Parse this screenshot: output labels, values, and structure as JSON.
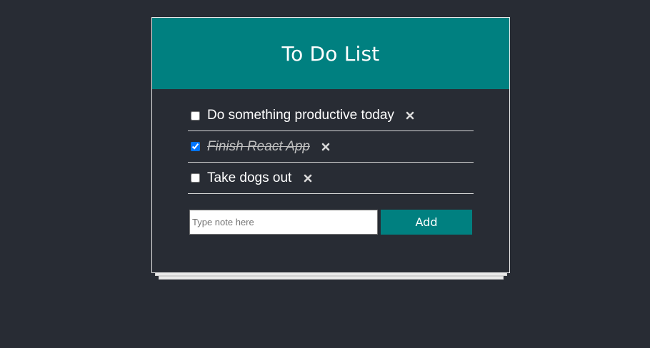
{
  "app": {
    "title": "To Do List"
  },
  "todos": [
    {
      "text": "Do something productive today",
      "completed": false
    },
    {
      "text": "Finish React App",
      "completed": true
    },
    {
      "text": "Take dogs out",
      "completed": false
    }
  ],
  "form": {
    "placeholder": "Type note here",
    "value": "",
    "add_label": "Add"
  },
  "icons": {
    "delete": "close-icon"
  },
  "colors": {
    "background": "#282c34",
    "accent": "#008080",
    "text": "#ffffff",
    "completed_text": "#bfbfbf"
  }
}
